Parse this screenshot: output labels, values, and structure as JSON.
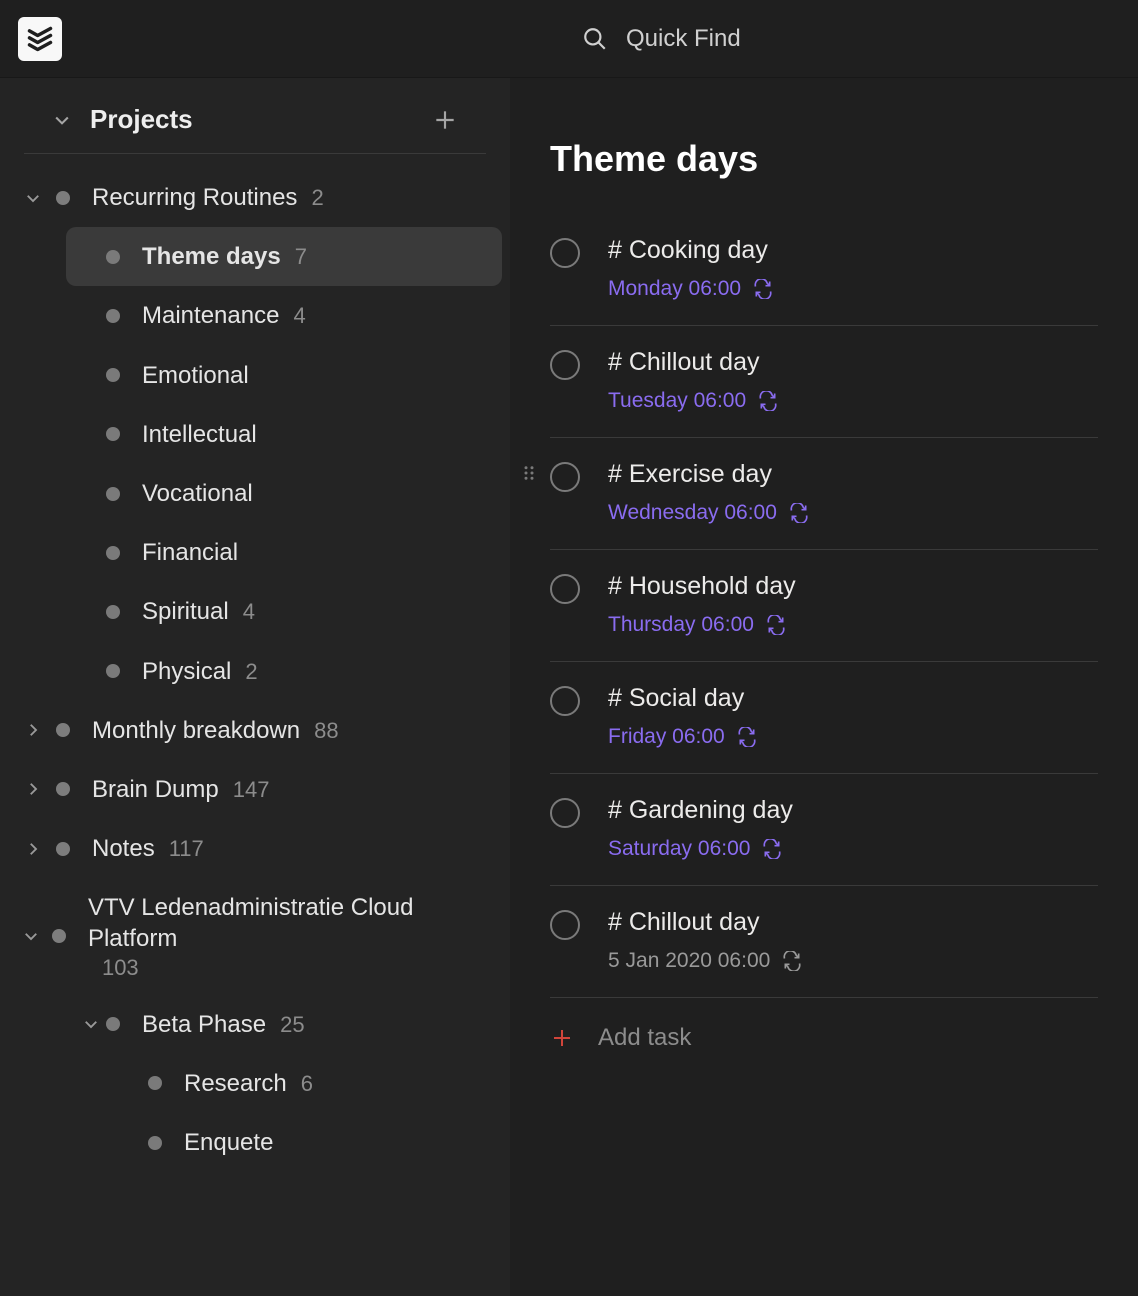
{
  "topbar": {
    "quick_find_label": "Quick Find"
  },
  "sidebar": {
    "section_title": "Projects",
    "items": [
      {
        "level": 0,
        "arrow": "down",
        "label": "Recurring Routines",
        "count": "2",
        "active": false
      },
      {
        "level": 1,
        "label": "Theme days",
        "count": "7",
        "active": true
      },
      {
        "level": 1,
        "label": "Maintenance",
        "count": "4"
      },
      {
        "level": 1,
        "label": "Emotional"
      },
      {
        "level": 1,
        "label": "Intellectual"
      },
      {
        "level": 1,
        "label": "Vocational"
      },
      {
        "level": 1,
        "label": "Financial"
      },
      {
        "level": 1,
        "label": "Spiritual",
        "count": "4"
      },
      {
        "level": 1,
        "label": "Physical",
        "count": "2"
      },
      {
        "level": 0,
        "arrow": "right",
        "label": "Monthly breakdown",
        "count": "88"
      },
      {
        "level": 0,
        "arrow": "right",
        "label": "Brain Dump",
        "count": "147"
      },
      {
        "level": 0,
        "arrow": "right",
        "label": "Notes",
        "count": "117"
      },
      {
        "level": 0,
        "arrow": "down",
        "label": "VTV Ledenadministratie Cloud Platform",
        "count": "103"
      },
      {
        "level": 1,
        "arrow": "down",
        "label": "Beta Phase",
        "count": "25"
      },
      {
        "level": 2,
        "label": "Research",
        "count": "6"
      },
      {
        "level": 2,
        "label": "Enquete"
      }
    ]
  },
  "content": {
    "title": "Theme days",
    "add_task_label": "Add task",
    "tasks": [
      {
        "title": "# Cooking day",
        "due": "Monday 06:00",
        "dueColor": "purple",
        "recurring": true
      },
      {
        "title": "# Chillout day",
        "due": "Tuesday 06:00",
        "dueColor": "purple",
        "recurring": true
      },
      {
        "title": "# Exercise day",
        "due": "Wednesday 06:00",
        "dueColor": "purple",
        "recurring": true,
        "drag": true
      },
      {
        "title": "# Household day",
        "due": "Thursday 06:00",
        "dueColor": "purple",
        "recurring": true
      },
      {
        "title": "# Social day",
        "due": "Friday 06:00",
        "dueColor": "purple",
        "recurring": true
      },
      {
        "title": "# Gardening day",
        "due": "Saturday 06:00",
        "dueColor": "purple",
        "recurring": true
      },
      {
        "title": "# Chillout day",
        "due": "5 Jan 2020 06:00",
        "dueColor": "gray",
        "recurring": true
      }
    ]
  }
}
